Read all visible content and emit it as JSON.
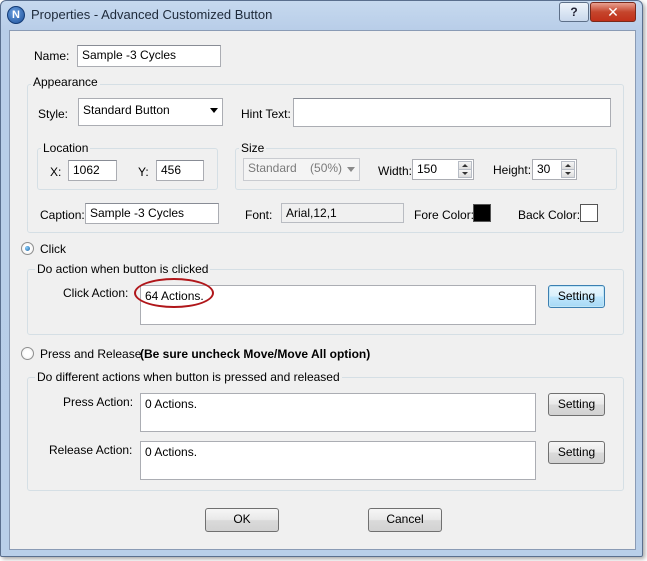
{
  "window": {
    "title": "Properties - Advanced Customized Button",
    "app_icon_letter": "N",
    "help_label": "?",
    "close_label": "✕"
  },
  "name": {
    "label": "Name:",
    "value": "Sample -3 Cycles"
  },
  "appearance": {
    "title": "Appearance",
    "style_label": "Style:",
    "style_value": "Standard Button",
    "hint_label": "Hint Text:",
    "hint_value": "",
    "location": {
      "title": "Location",
      "x_label": "X:",
      "x_value": "1062",
      "y_label": "Y:",
      "y_value": "456"
    },
    "size": {
      "title": "Size",
      "preset_value": "Standard    (50%)",
      "width_label": "Width:",
      "width_value": "150",
      "height_label": "Height:",
      "height_value": "30"
    },
    "caption_label": "Caption:",
    "caption_value": "Sample -3 Cycles",
    "font_label": "Font:",
    "font_value": "Arial,12,1",
    "fore_color_label": "Fore Color:",
    "fore_color": "#000000",
    "back_color_label": "Back Color:",
    "back_color": "#ffffff"
  },
  "click": {
    "radio_label": "Click",
    "selected": true,
    "group_title": "Do action when button is clicked",
    "action_label": "Click Action:",
    "action_value": "64 Actions.",
    "setting_label": "Setting"
  },
  "press_release": {
    "radio_label": "Press and Release",
    "note": "(Be sure uncheck Move/Move All option)",
    "selected": false,
    "group_title": "Do different actions when button is pressed and released",
    "press_label": "Press Action:",
    "press_value": "0 Actions.",
    "release_label": "Release Action:",
    "release_value": "0 Actions.",
    "setting_label": "Setting"
  },
  "footer": {
    "ok_label": "OK",
    "cancel_label": "Cancel"
  },
  "colors": {
    "annotation_ring": "#b0161a",
    "focus_button": "#3c7fb1"
  }
}
